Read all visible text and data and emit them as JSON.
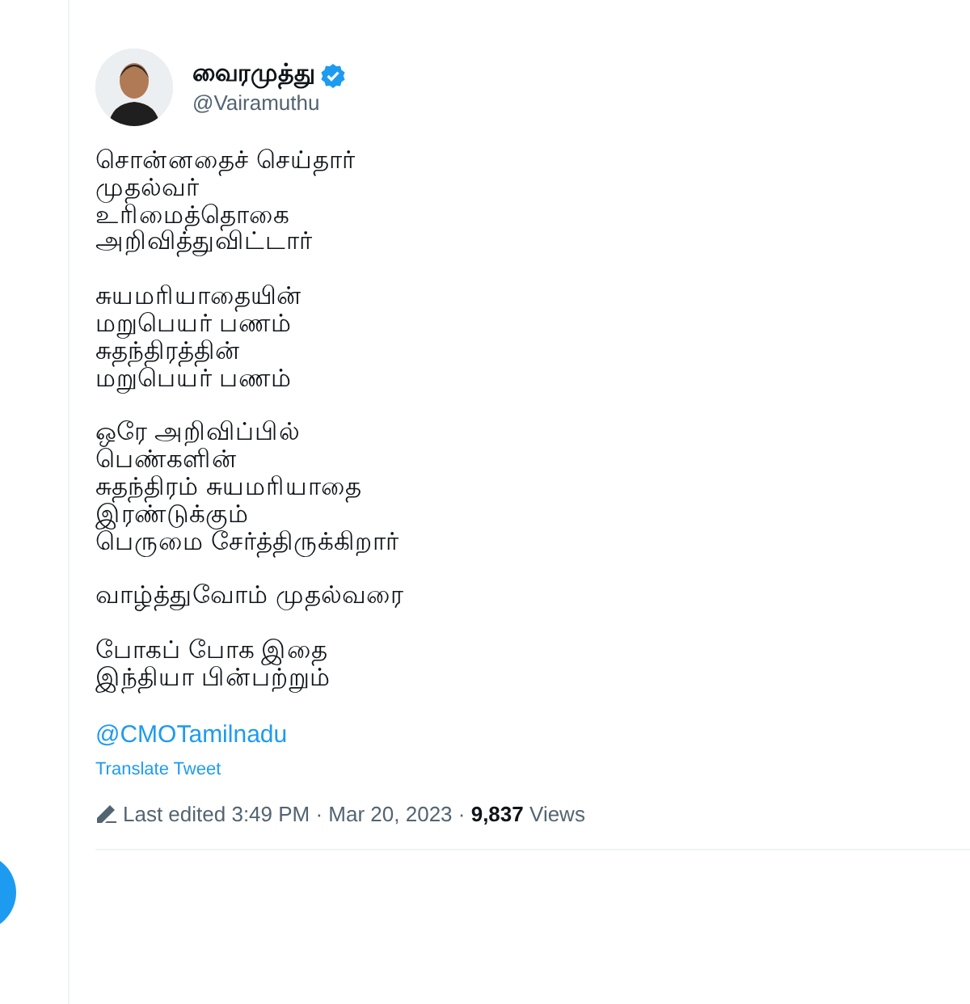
{
  "author": {
    "name": "வைரமுத்து",
    "handle": "@Vairamuthu",
    "verified": true
  },
  "stanzas": [
    [
      "சொன்னதைச் செய்தார்",
      "முதல்வர்",
      "உரிமைத்தொகை",
      "அறிவித்துவிட்டார்"
    ],
    [
      "சுயமரியாதையின்",
      "மறுபெயர் பணம்",
      "சுதந்திரத்தின்",
      "மறுபெயர் பணம்"
    ],
    [
      "ஒரே அறிவிப்பில்",
      "பெண்களின்",
      "சுதந்திரம் சுயமரியாதை",
      "இரண்டுக்கும்",
      "பெருமை சேர்த்திருக்கிறார்"
    ],
    [
      "வாழ்த்துவோம் முதல்வரை"
    ],
    [
      "போகப் போக இதை",
      "இந்தியா பின்பற்றும்"
    ]
  ],
  "mention": "@CMOTamilnadu",
  "translate": "Translate Tweet",
  "meta": "Last edited 3:49 PM · Mar 20, 2023 · **9,837** Views"
}
